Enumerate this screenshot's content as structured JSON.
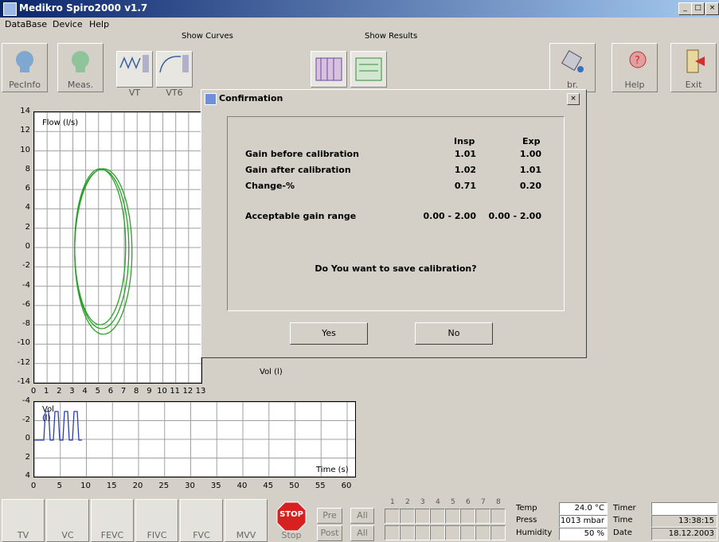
{
  "window": {
    "title": "Medikro Spiro2000 v1.7",
    "controls": [
      "_",
      "□",
      "×"
    ]
  },
  "menu": [
    "DataBase",
    "Device",
    "Help"
  ],
  "toolbar": {
    "show_curves_label": "Show Curves",
    "show_results_label": "Show Results",
    "buttons": {
      "pecinfo": "PecInfo",
      "meas": "Meas.",
      "vt": "VT",
      "vt6": "VT6",
      "calibr": "br.",
      "help": "Help",
      "exit": "Exit"
    }
  },
  "flow_plot": {
    "ylabel": "Flow (l/s)",
    "xlabel": "Vol (l)",
    "yticks": [
      "14",
      "12",
      "10",
      "8",
      "6",
      "4",
      "2",
      "0",
      "-2",
      "-4",
      "-6",
      "-8",
      "-10",
      "-12",
      "-14"
    ],
    "xticks": [
      "0",
      "1",
      "2",
      "3",
      "4",
      "5",
      "6",
      "7",
      "8",
      "9",
      "10",
      "11",
      "12",
      "13"
    ]
  },
  "time_plot": {
    "ylabel": "Vol (l)",
    "xlabel": "Time (s)",
    "yticks": [
      "-4",
      "-2",
      "0",
      "2",
      "4"
    ],
    "xticks": [
      "0",
      "5",
      "10",
      "15",
      "20",
      "25",
      "30",
      "35",
      "40",
      "45",
      "50",
      "55",
      "60"
    ]
  },
  "dialog": {
    "title": "Confirmation",
    "close": "×",
    "col_insp": "Insp",
    "col_exp": "Exp",
    "rows": [
      {
        "label": "Gain before calibration",
        "insp": "1.01",
        "exp": "1.00"
      },
      {
        "label": "Gain after calibration",
        "insp": "1.02",
        "exp": "1.01"
      },
      {
        "label": "Change-%",
        "insp": "0.71",
        "exp": "0.20"
      }
    ],
    "range_label": "Acceptable gain range",
    "range_insp": "0.00 - 2.00",
    "range_exp": "0.00 - 2.00",
    "question": "Do You want to save calibration?",
    "yes": "Yes",
    "no": "No"
  },
  "bottom": {
    "thumbs": [
      "TV",
      "VC",
      "FEVC",
      "FIVC",
      "FVC",
      "MVV"
    ],
    "stop_icon_text": "STOP",
    "stop_label": "Stop",
    "pre": "Pre",
    "post": "Post",
    "all1": "All",
    "all2": "All",
    "slot_numbers": [
      "1",
      "2",
      "3",
      "4",
      "5",
      "6",
      "7",
      "8"
    ],
    "temp_label": "Temp",
    "temp_value": "24.0 °C",
    "press_label": "Press",
    "press_value": "1013 mbar",
    "humidity_label": "Humidity",
    "humidity_value": "50 %",
    "timer_label": "Timer",
    "timer_value": "",
    "time_label": "Time",
    "time_value": "13:38:15",
    "date_label": "Date",
    "date_value": "18.12.2003"
  }
}
